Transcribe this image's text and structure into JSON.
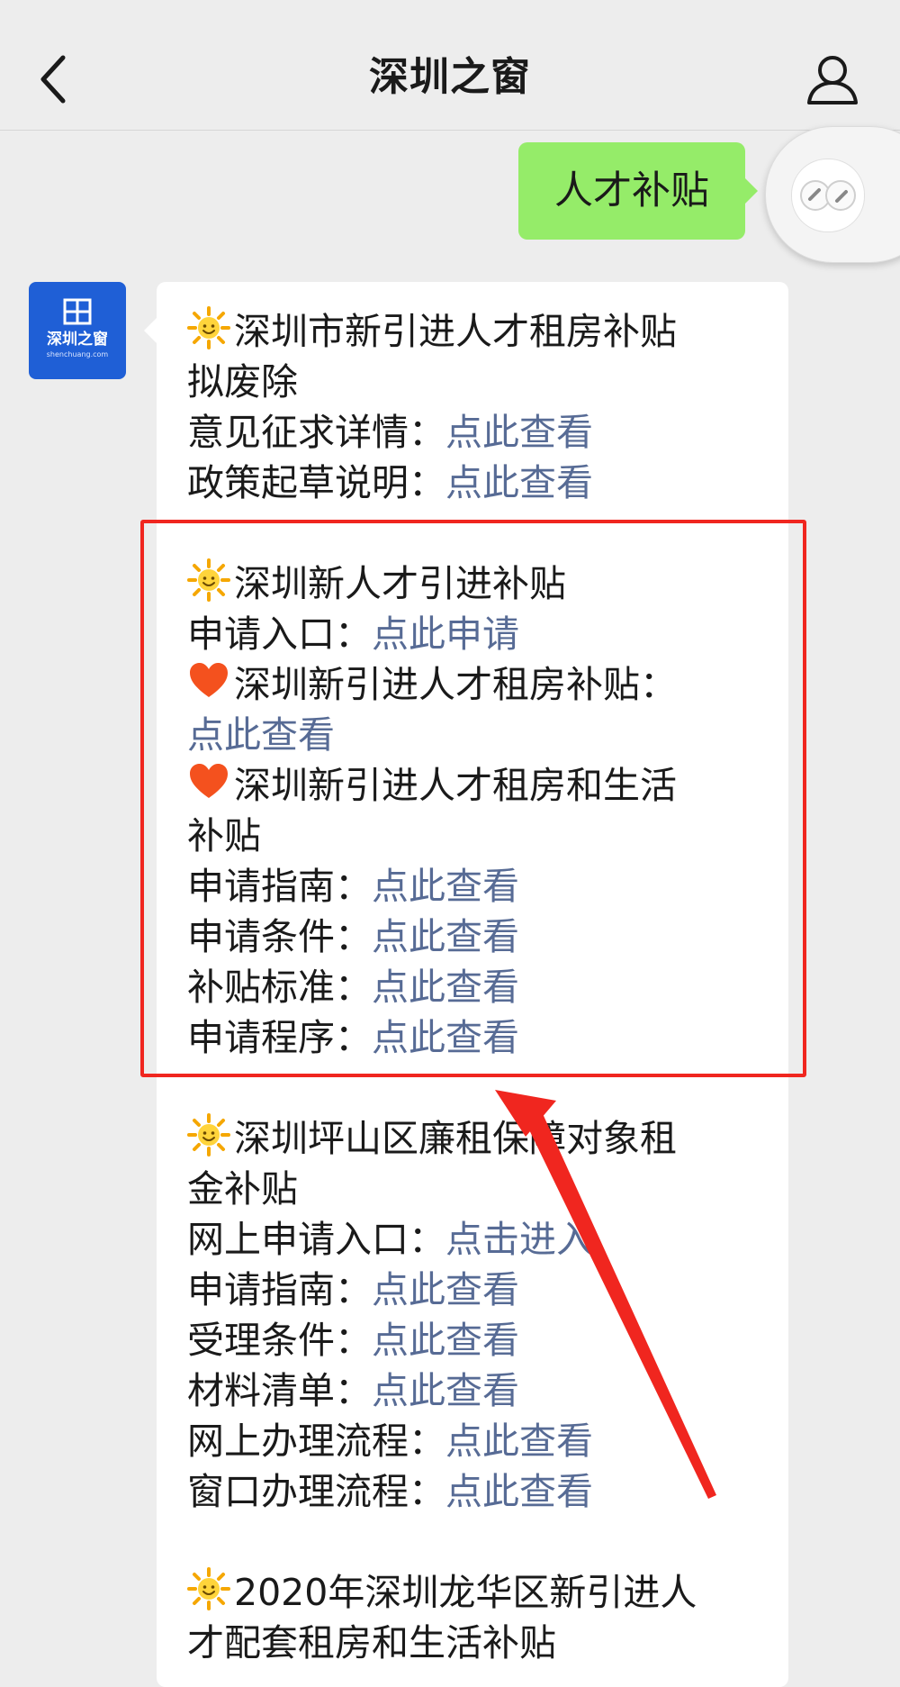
{
  "header": {
    "title": "深圳之窗",
    "back_icon": "chevron-left-icon",
    "profile_icon": "person-icon"
  },
  "user_message": "人才补贴",
  "avatar": {
    "logo_text": "深圳之窗",
    "logo_sub": "shenchuang.com"
  },
  "colors": {
    "user_bubble": "#95ec69",
    "link": "#576b95",
    "highlight": "#f0261f",
    "avatar_bg": "#1f5fd6"
  },
  "bot_message": {
    "sections": [
      {
        "lines": [
          {
            "emoji": "sun",
            "text": "深圳市新引进人才租房补贴"
          },
          {
            "text": "拟废除"
          },
          {
            "label": "意见征求详情：",
            "link": "点此查看"
          },
          {
            "label": "政策起草说明：",
            "link": "点此查看"
          }
        ]
      },
      {
        "lines": [
          {
            "emoji": "sun",
            "text": "深圳新人才引进补贴"
          },
          {
            "label": "申请入口：",
            "link": "点此申请"
          },
          {
            "emoji": "heart",
            "text": "深圳新引进人才租房补贴："
          },
          {
            "link": "点此查看"
          },
          {
            "emoji": "heart",
            "text": "深圳新引进人才租房和生活"
          },
          {
            "text": "补贴"
          },
          {
            "label": "申请指南：",
            "link": "点此查看"
          },
          {
            "label": "申请条件：",
            "link": "点此查看"
          },
          {
            "label": "补贴标准：",
            "link": "点此查看"
          },
          {
            "label": "申请程序：",
            "link": "点此查看"
          }
        ]
      },
      {
        "lines": [
          {
            "emoji": "sun",
            "text": "深圳坪山区廉租保障对象租"
          },
          {
            "text": "金补贴"
          },
          {
            "label": "网上申请入口：",
            "link": "点击进入"
          },
          {
            "label": "申请指南：",
            "link": "点此查看"
          },
          {
            "label": "受理条件：",
            "link": "点此查看"
          },
          {
            "label": "材料清单：",
            "link": "点此查看"
          },
          {
            "label": "网上办理流程：",
            "link": "点此查看"
          },
          {
            "label": "窗口办理流程：",
            "link": "点此查看"
          }
        ]
      },
      {
        "lines": [
          {
            "emoji": "sun",
            "text": "2020年深圳龙华区新引进人"
          },
          {
            "text": "才配套租房和生活补贴"
          }
        ]
      }
    ]
  }
}
